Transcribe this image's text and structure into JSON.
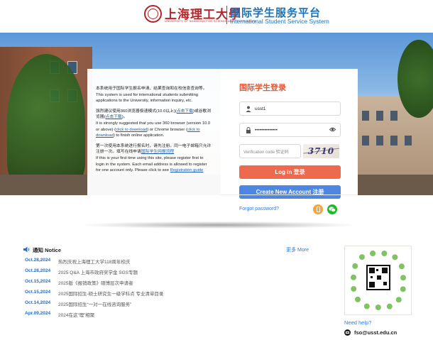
{
  "header": {
    "university_cn": "上海理工大學",
    "university_en": "UNIVERSITY OF SHANGHAI FOR SCIENCE AND TECHNOLOGY",
    "system_cn": "国际学生服务平台",
    "system_en": "International Student Service System"
  },
  "info": {
    "p1_cn": "本系统用于国际学生报名申请、结果查询和在校信息查询等。",
    "p1_en": "This system is used for international students submitting applications to the University, information inquiry, etc.",
    "p2_cn_a": "强烈建议使用360浏览器极速模式(10.0以上)(",
    "p2_cn_link1": "点击下载",
    "p2_cn_b": ")或谷歌浏览器(",
    "p2_cn_link2": "点击下载",
    "p2_cn_c": ")。",
    "p2_en_a": "It is strongly suggested that you use 360 browser (version 10.0 or above) (",
    "p2_en_link1": "click to download",
    "p2_en_b": ") or Chrome browser (",
    "p2_en_link2": "click to download",
    "p2_en_c": ") to finish online application.",
    "p3_cn_a": "第一次使用本系统进行报名时，请先注册。同一电子邮箱只允许注册一次。填写在线申请",
    "p3_cn_link": "国际学生网报流程",
    "p3_en_a": "If this is your first time using this site, please register first to login in the system. Each email address is allowed to register for one account only. Please click to see",
    "p3_en_link": "Registration guide"
  },
  "login": {
    "title": "国际学生登录",
    "username_value": "usst1",
    "password_value": "••••••••••••••",
    "captcha_placeholder": "Verification code 验证码",
    "captcha_text": "3710",
    "login_button": "Log in 登录",
    "create_button": "Create New Account 注册",
    "forgot": "Forgot password?"
  },
  "notice": {
    "title": "通知  Notice",
    "more": "更多 More",
    "items": [
      {
        "date": "Oct.28,2024",
        "text": "热烈庆祝上海理工大学118周年校庆"
      },
      {
        "date": "Oct.28,2024",
        "text": "2025 Q&A 上海市政府奖学金 SGS专题"
      },
      {
        "date": "Oct.15,2024",
        "text": "2025版《报销政策》硕博层次申请者"
      },
      {
        "date": "Oct.15,2024",
        "text": "2025国际招生-硕士研究生一级学科点 专业清单目录"
      },
      {
        "date": "Oct.14,2024",
        "text": "2025国际招生“一对一在线咨询服务”"
      },
      {
        "date": "Apr.09,2024",
        "text": "2024在这“理”相聚"
      }
    ]
  },
  "contact": {
    "need_help": "Need help?",
    "email": "fso@usst.edu.cn"
  },
  "colors": {
    "brand_red": "#b5252b",
    "brand_blue": "#1b72b5",
    "login_orange": "#ee6a4e",
    "create_blue": "#4d86e3",
    "date_blue": "#2b6cc6"
  },
  "icons": [
    "usst-seal-icon",
    "user-icon",
    "lock-icon",
    "eye-icon",
    "app-phone-icon",
    "wechat-icon",
    "speaker-icon",
    "email-icon",
    "qr-code-icon"
  ]
}
